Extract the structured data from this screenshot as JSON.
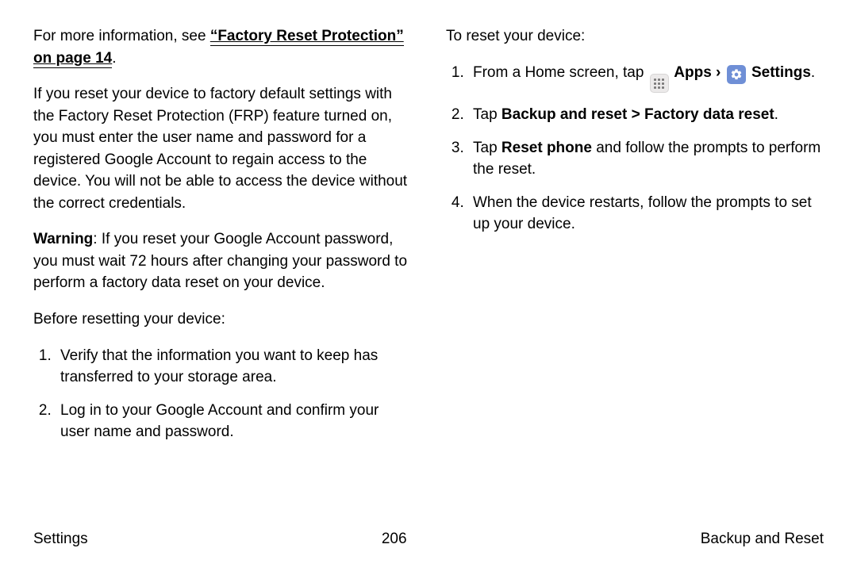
{
  "left": {
    "intro_prefix": "For more information, see ",
    "intro_link": "“Factory Reset Protection” on page 14",
    "intro_suffix": ".",
    "frp_body": "If you reset your device to factory default settings with the Factory Reset Protection (FRP) feature turned on, you must enter the user name and password for a registered Google Account to regain access to the device. You will not be able to access the device without the correct credentials.",
    "warn_label": "Warning",
    "warn_body": ": If you reset your Google Account password, you must wait 72 hours after changing your password to perform a factory data reset on your device.",
    "before_label": "Before resetting your device:",
    "before_items": [
      "Verify that the information you want to keep has transferred to your storage area.",
      "Log in to your Google Account and confirm your user name and password."
    ]
  },
  "right": {
    "toreset_label": "To reset your device:",
    "step1_a": "From a Home screen, tap ",
    "step1_apps": " Apps",
    "step1_sep": " › ",
    "step1_settings": " Settings",
    "step1_end": ".",
    "step2_a": "Tap ",
    "step2_b": "Backup and reset",
    "step2_c": " > ",
    "step2_d": "Factory data reset",
    "step2_e": ".",
    "step3_a": "Tap ",
    "step3_b": "Reset phone",
    "step3_c": " and follow the prompts to perform the reset.",
    "step4": "When the device restarts, follow the prompts to set up your device."
  },
  "footer": {
    "left": "Settings",
    "center": "206",
    "right": "Backup and Reset"
  }
}
